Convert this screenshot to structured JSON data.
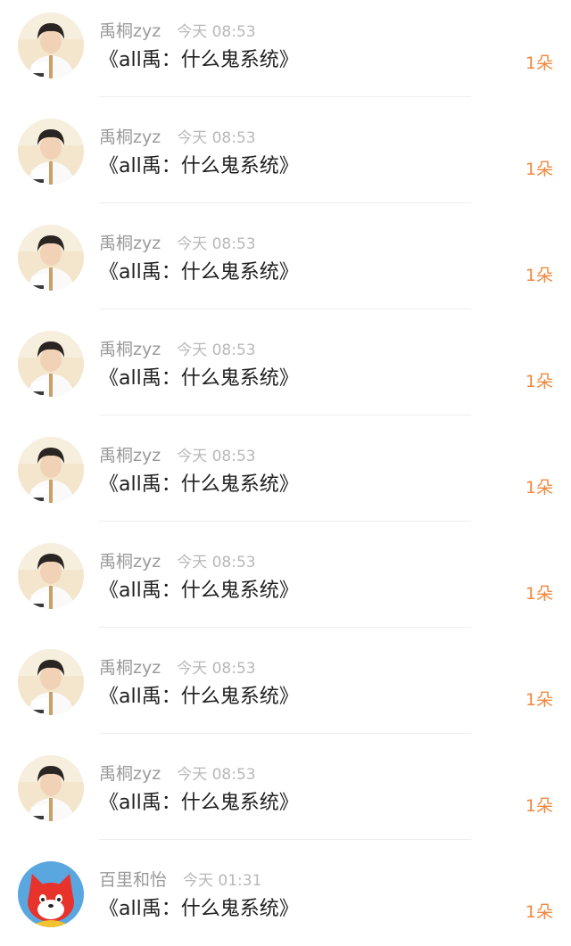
{
  "rows": [
    {
      "name": "禹桐zyz",
      "time": "今天 08:53",
      "message": "《all禹：什么鬼系统》",
      "count": "1朵",
      "avatar": "boy-photo-avatar"
    },
    {
      "name": "禹桐zyz",
      "time": "今天 08:53",
      "message": "《all禹：什么鬼系统》",
      "count": "1朵",
      "avatar": "boy-photo-avatar"
    },
    {
      "name": "禹桐zyz",
      "time": "今天 08:53",
      "message": "《all禹：什么鬼系统》",
      "count": "1朵",
      "avatar": "boy-photo-avatar"
    },
    {
      "name": "禹桐zyz",
      "time": "今天 08:53",
      "message": "《all禹：什么鬼系统》",
      "count": "1朵",
      "avatar": "boy-photo-avatar"
    },
    {
      "name": "禹桐zyz",
      "time": "今天 08:53",
      "message": "《all禹：什么鬼系统》",
      "count": "1朵",
      "avatar": "boy-photo-avatar"
    },
    {
      "name": "禹桐zyz",
      "time": "今天 08:53",
      "message": "《all禹：什么鬼系统》",
      "count": "1朵",
      "avatar": "boy-photo-avatar"
    },
    {
      "name": "禹桐zyz",
      "time": "今天 08:53",
      "message": "《all禹：什么鬼系统》",
      "count": "1朵",
      "avatar": "boy-photo-avatar"
    },
    {
      "name": "禹桐zyz",
      "time": "今天 08:53",
      "message": "《all禹：什么鬼系统》",
      "count": "1朵",
      "avatar": "boy-photo-avatar"
    },
    {
      "name": "百里和怡",
      "time": "今天 01:31",
      "message": "《all禹：什么鬼系统》",
      "count": "1朵",
      "avatar": "red-fox-cartoon-avatar"
    }
  ],
  "colors": {
    "name_text": "#9a9a9a",
    "time_text": "#b8b8b8",
    "message_text": "#1f1f1f",
    "count_accent": "#f0883f",
    "divider": "#eeeeee"
  }
}
